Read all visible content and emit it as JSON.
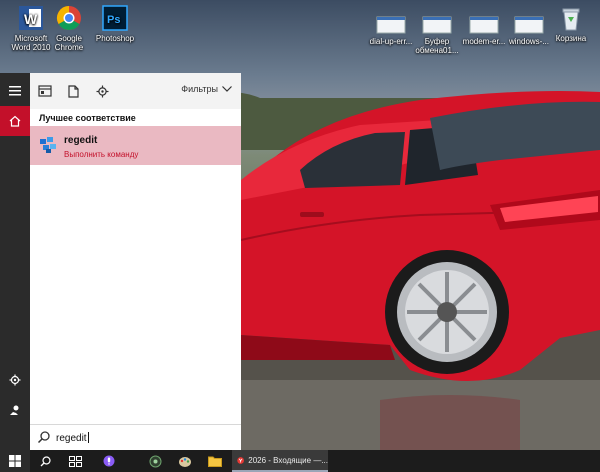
{
  "desktop": {
    "left_icons": [
      {
        "label_line1": "Microsoft",
        "label_line2": "Word 2010",
        "icon": "word-icon"
      },
      {
        "label_line1": "Google",
        "label_line2": "Chrome",
        "icon": "chrome-icon"
      },
      {
        "label_line1": "Photoshop",
        "label_line2": "",
        "icon": "photoshop-icon"
      }
    ],
    "right_icons": [
      {
        "label_line1": "dial-up-err...",
        "label_line2": "",
        "icon": "screenshot-file-icon"
      },
      {
        "label_line1": "Буфер",
        "label_line2": "обмена01...",
        "icon": "screenshot-file-icon"
      },
      {
        "label_line1": "modem-er...",
        "label_line2": "",
        "icon": "screenshot-file-icon"
      },
      {
        "label_line1": "windows-...",
        "label_line2": "",
        "icon": "screenshot-file-icon"
      },
      {
        "label_line1": "Корзина",
        "label_line2": "",
        "icon": "recycle-bin-icon"
      }
    ]
  },
  "start_menu": {
    "filters_label": "Фильтры",
    "best_match_heading": "Лучшее соответствие",
    "result": {
      "title": "regedit",
      "subtitle": "Выполнить команду",
      "icon": "regedit-icon"
    },
    "search": {
      "value": "regedit",
      "icon": "search-icon"
    }
  },
  "taskbar": {
    "active_app_label": "2026 - Входящие —..."
  },
  "colors": {
    "accent": "#c3102a",
    "selected_result_bg": "#eab9c2",
    "rail_bg": "#2b2b2b",
    "taskbar_bg": "#1c1c1c"
  }
}
